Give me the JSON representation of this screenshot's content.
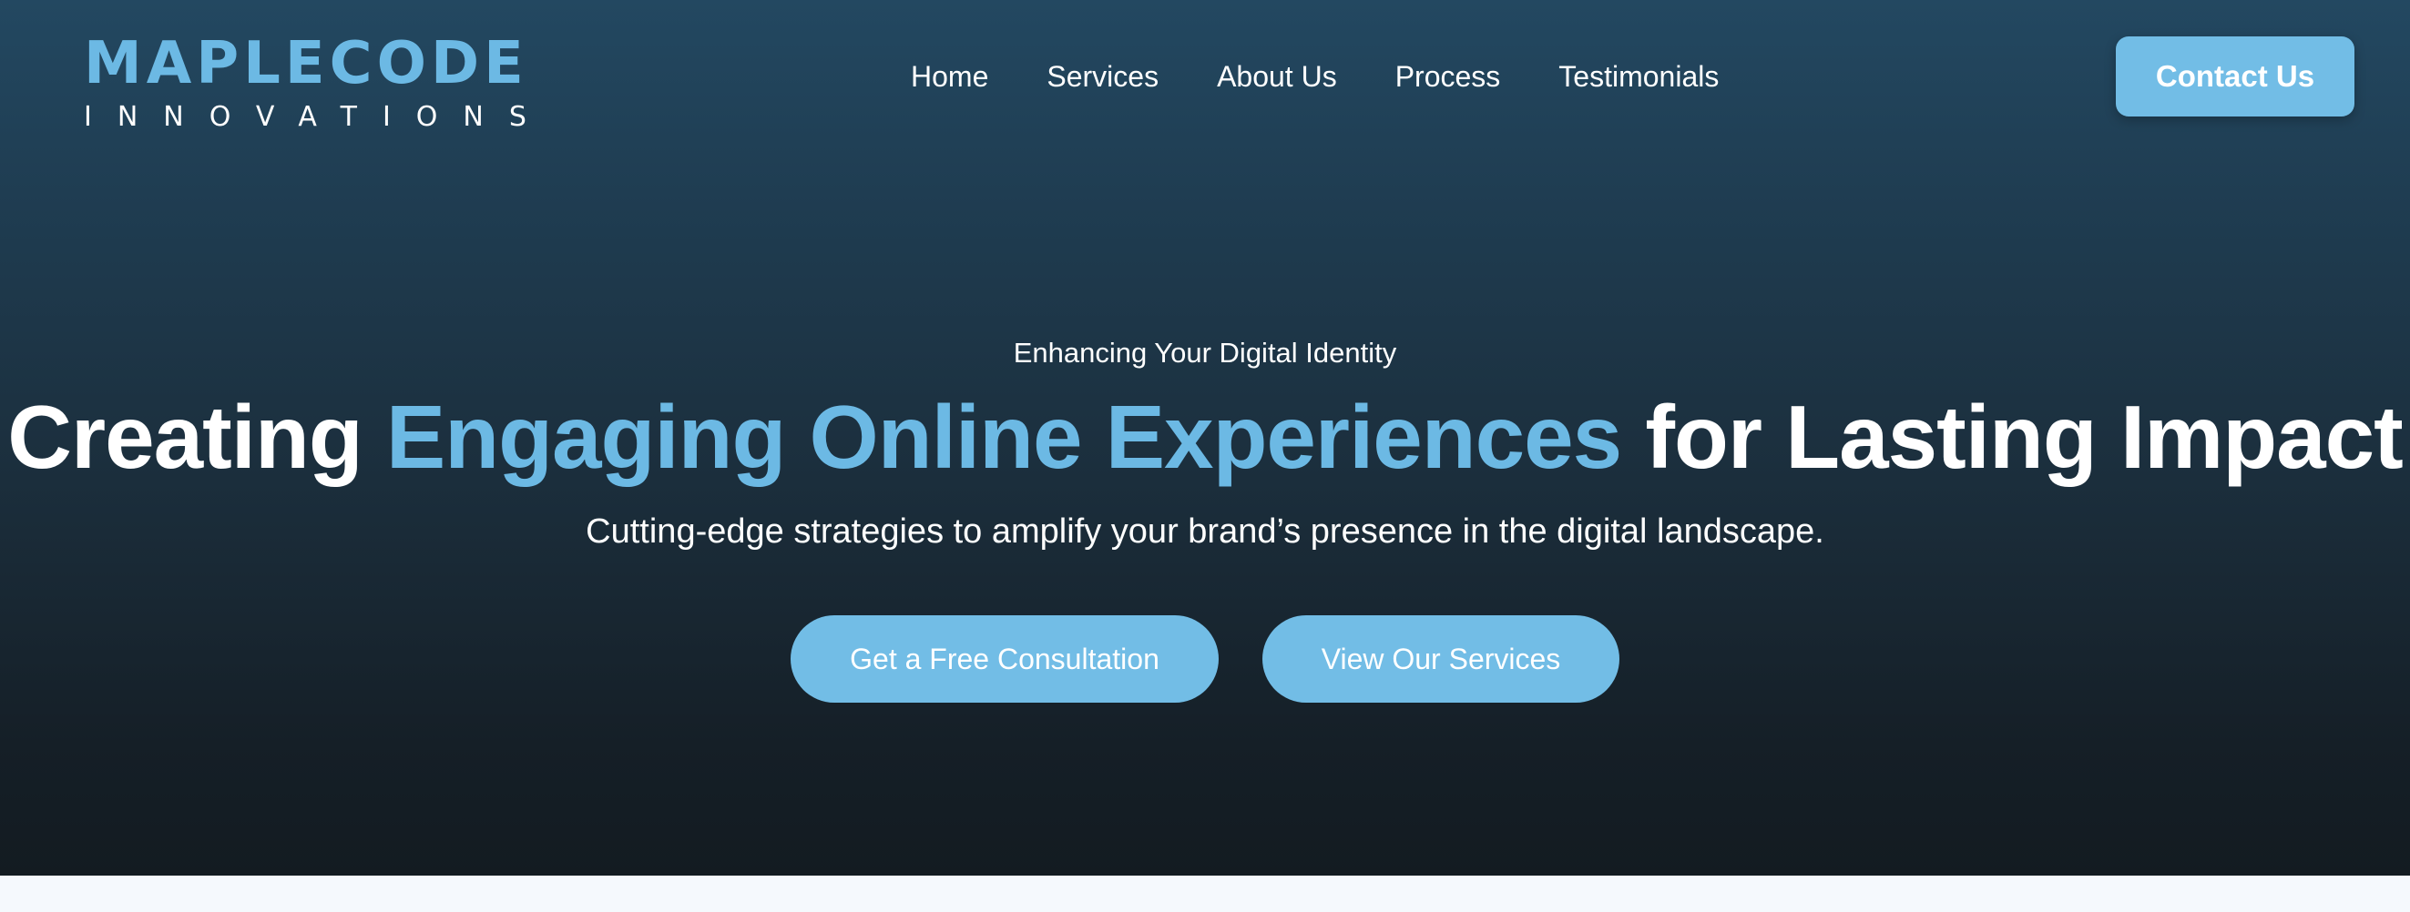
{
  "brand": {
    "name": "MAPLECODE",
    "tagline": "INNOVATIONS",
    "accent_color": "#6cb9e4"
  },
  "nav": {
    "items": [
      {
        "label": "Home"
      },
      {
        "label": "Services"
      },
      {
        "label": "About Us"
      },
      {
        "label": "Process"
      },
      {
        "label": "Testimonials"
      }
    ],
    "contact_label": "Contact Us"
  },
  "hero": {
    "eyebrow": "Enhancing Your Digital Identity",
    "headline_part1": "Creating ",
    "headline_accent": "Engaging Online Experiences",
    "headline_part2": " for Lasting Impact",
    "subheadline": "Cutting-edge strategies to amplify your brand’s presence in the digital landscape.",
    "primary_cta": "Get a Free Consultation",
    "secondary_cta": "View Our Services"
  },
  "colors": {
    "button_bg": "#72bde6",
    "hero_top": "#234861",
    "hero_bottom": "#131b21",
    "page_bg": "#f5f9fd"
  }
}
